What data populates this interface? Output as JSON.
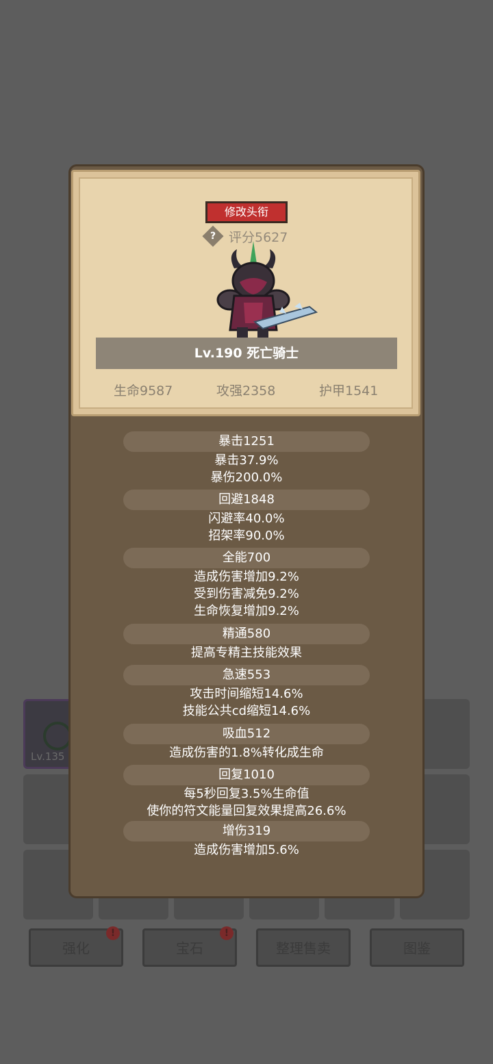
{
  "popup": {
    "rename_label": "修改头衔",
    "help_symbol": "?",
    "score": "评分5627",
    "name": "Lv.190 死亡骑士",
    "stats": {
      "hp": "生命9587",
      "attack": "攻强2358",
      "armor": "护甲1541"
    },
    "attributes": [
      {
        "title": "暴击1251",
        "lines": [
          "暴击37.9%",
          "暴伤200.0%"
        ]
      },
      {
        "title": "回避1848",
        "lines": [
          "闪避率40.0%",
          "招架率90.0%"
        ]
      },
      {
        "title": "全能700",
        "lines": [
          "造成伤害增加9.2%",
          "受到伤害减免9.2%",
          "生命恢复增加9.2%"
        ]
      },
      {
        "title": "精通580",
        "lines": [
          "提高专精主技能效果"
        ]
      },
      {
        "title": "急速553",
        "lines": [
          "攻击时间缩短14.6%",
          "技能公共cd缩短14.6%"
        ]
      },
      {
        "title": "吸血512",
        "lines": [
          "造成伤害的1.8%转化成生命"
        ]
      },
      {
        "title": "回复1010",
        "lines": [
          "每5秒回复3.5%生命值",
          "使你的符文能量回复效果提高26.6%"
        ]
      },
      {
        "title": "增伤319",
        "lines": [
          "造成伤害增加5.6%"
        ]
      }
    ]
  },
  "background": {
    "slot_level": "Lv.135",
    "buttons": [
      "强化",
      "宝石",
      "整理售卖",
      "图鉴"
    ],
    "alert_symbol": "!"
  },
  "colors": {
    "accent_red": "#c0302f",
    "parchment": "#e8d4ad",
    "panel": "#6b5a45"
  },
  "icons": [
    "help-icon",
    "death-knight-character",
    "ring-icon",
    "alert-icon"
  ]
}
